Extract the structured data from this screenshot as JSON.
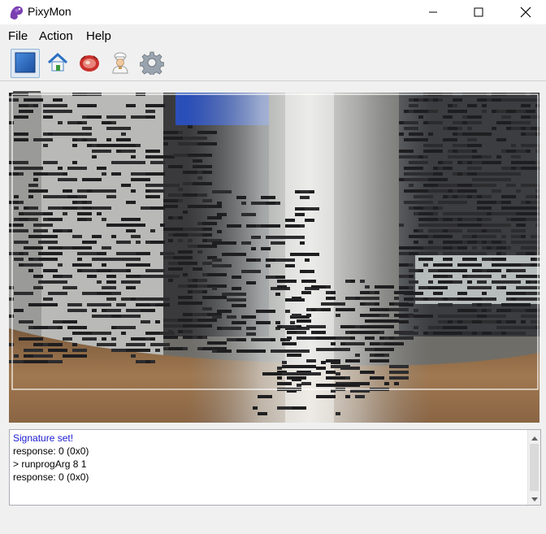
{
  "window": {
    "title": "PixyMon",
    "app_icon": "pixymon-dragon-icon",
    "controls": [
      "minimize-icon",
      "maximize-icon",
      "close-icon"
    ]
  },
  "menu": {
    "items": [
      {
        "label": "File"
      },
      {
        "label": "Action"
      },
      {
        "label": "Help"
      }
    ]
  },
  "toolbar": {
    "buttons": [
      {
        "icon": "run-pause-icon",
        "active": true
      },
      {
        "icon": "home-icon",
        "active": false
      },
      {
        "icon": "raw-video-icon",
        "active": false
      },
      {
        "icon": "chef-icon",
        "active": false
      },
      {
        "icon": "gear-icon",
        "active": false
      }
    ]
  },
  "console": {
    "lines": [
      {
        "text": "Signature set!",
        "kind": "info"
      },
      {
        "text": "response: 0 (0x0)",
        "kind": "normal"
      },
      {
        "text": "> runprogArg 8 1",
        "kind": "normal"
      },
      {
        "text": "response: 0 (0x0)",
        "kind": "normal"
      }
    ]
  },
  "colors": {
    "info_text": "#1a1ad0",
    "window_bg": "#f0f0f0",
    "active_button_border": "#8fb5d8"
  }
}
